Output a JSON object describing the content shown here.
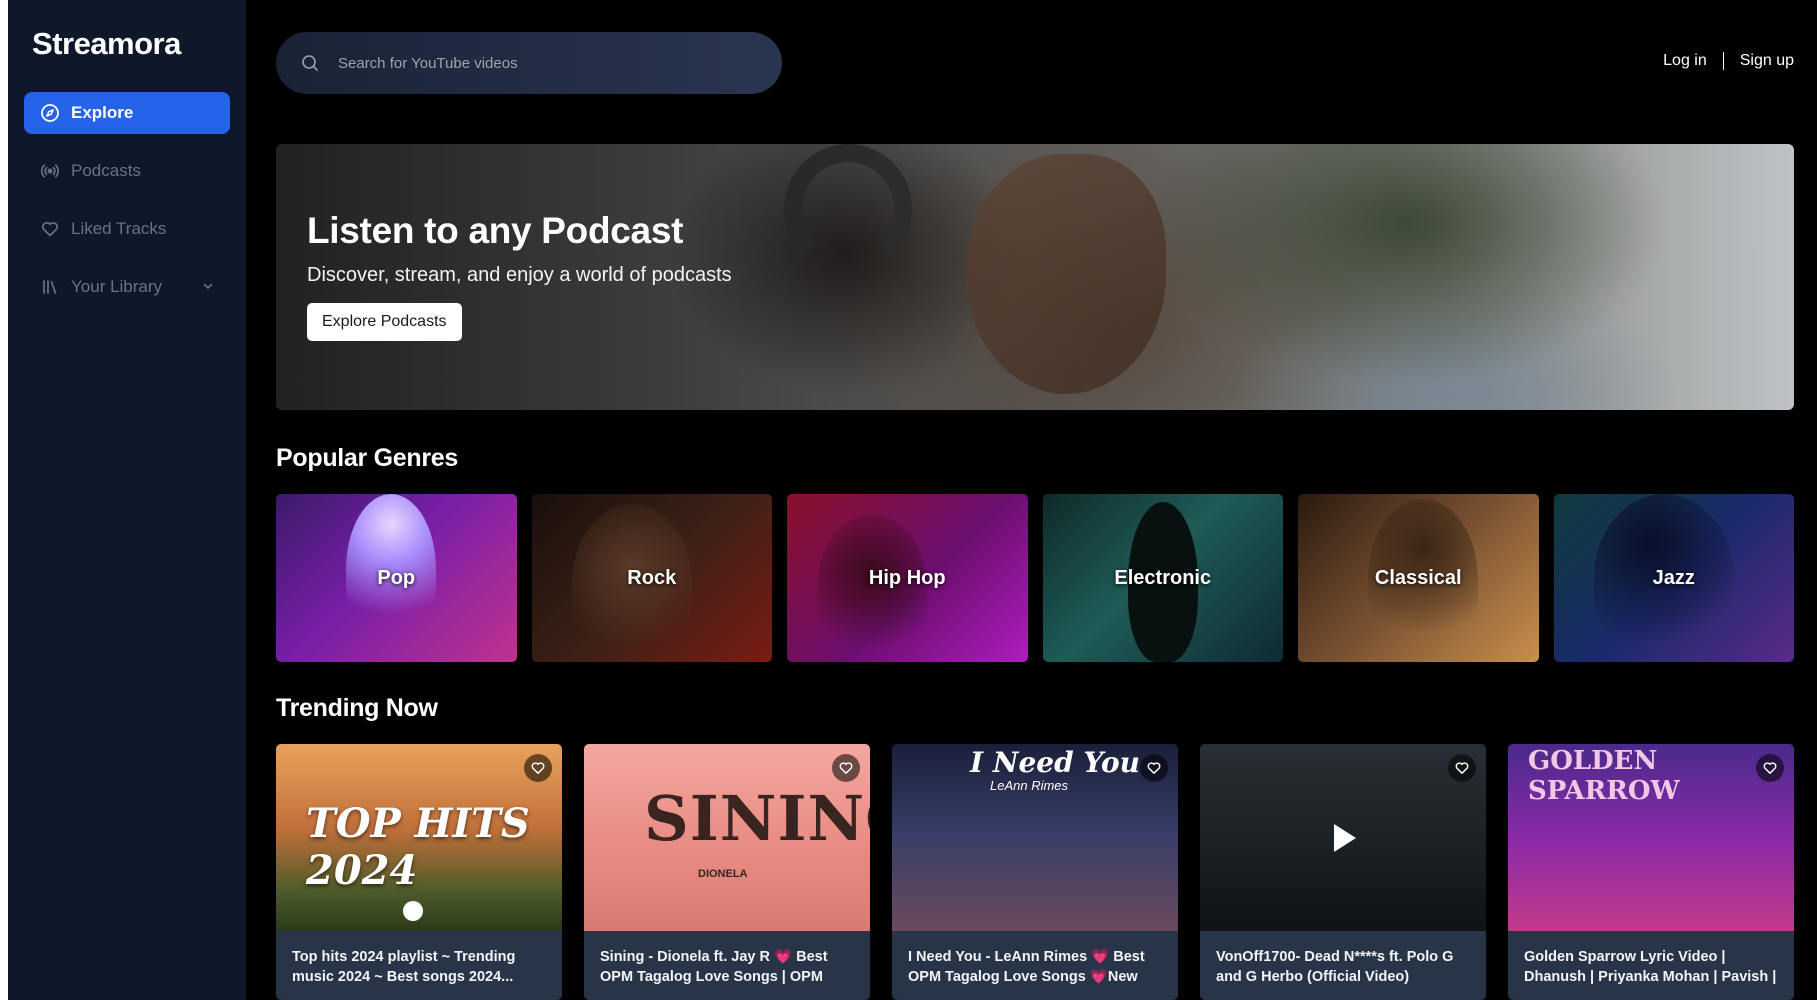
{
  "brand": "Streamora",
  "sidebar": {
    "items": [
      {
        "label": "Explore",
        "icon": "compass-icon",
        "active": true
      },
      {
        "label": "Podcasts",
        "icon": "broadcast-icon"
      },
      {
        "label": "Liked Tracks",
        "icon": "heart-icon"
      },
      {
        "label": "Your Library",
        "icon": "library-icon",
        "expandable": true
      }
    ]
  },
  "search": {
    "placeholder": "Search for YouTube videos"
  },
  "auth": {
    "login": "Log in",
    "signup": "Sign up"
  },
  "hero": {
    "title": "Listen to any Podcast",
    "subtitle": "Discover, stream, and enjoy a world of podcasts",
    "button": "Explore Podcasts"
  },
  "genres": {
    "title": "Popular Genres",
    "items": [
      "Pop",
      "Rock",
      "Hip Hop",
      "Electronic",
      "Classical",
      "Jazz"
    ]
  },
  "trending": {
    "title": "Trending Now",
    "items": [
      {
        "title": "Top hits 2024 playlist ~ Trending music 2024 ~ Best songs 2024...",
        "thumb_text": "TOP HITS 2024"
      },
      {
        "title": "Sining - Dionela ft. Jay R 💗 Best OPM Tagalog Love Songs | OPM Tagalog...",
        "thumb_text": "SINING",
        "thumb_subtext": "DIONELA"
      },
      {
        "title": "I Need You - LeAnn Rimes 💗 Best OPM Tagalog Love Songs 💗New OP...",
        "thumb_text": "I Need You",
        "thumb_subtext": "LeAnn Rimes"
      },
      {
        "title": "VonOff1700- Dead N****s ft. Polo G and G Herbo (Official Video)"
      },
      {
        "title": "Golden Sparrow Lyric Video | Dhanush | Priyanka Mohan | Pavish | Anikha |...",
        "thumb_text": "GOLDEN SPARROW"
      }
    ]
  },
  "colors": {
    "accent": "#2563eb",
    "sidebar": "#0f172a",
    "card": "#283548"
  }
}
